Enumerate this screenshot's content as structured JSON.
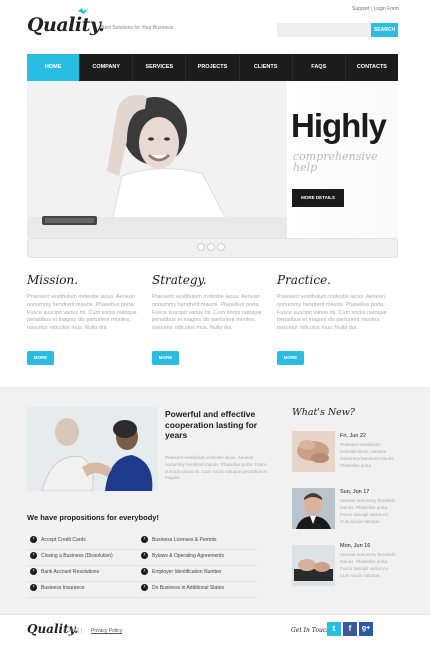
{
  "header": {
    "logo": "Quality.",
    "tagline": "Best Solutions for Your Business",
    "support": "Support",
    "login": "Login Form",
    "search_button": "SEARCH"
  },
  "nav": [
    "HOME",
    "COMPANY",
    "SERVICES",
    "PROJECTS",
    "CLIENTS",
    "FAQS",
    "CONTACTS"
  ],
  "hero": {
    "title": "Highly",
    "subtitle": "comprehensive help",
    "button": "MORE DETAILS"
  },
  "columns": [
    {
      "title": "Mission.",
      "text": "Praesent vestibulum molestie lacus. Aenean nonummy hendrerit mauris. Phasellus porta. Fusce suscipit varius mi. Cum sociis natoque penatibus et magnis dis parturient montes, nascetur ridiculus mus. Nulla dui.",
      "button": "MORE"
    },
    {
      "title": "Strategy.",
      "text": "Praesent vestibulum molestie lacus. Aenean nonummy hendrerit mauris. Phasellus porta. Fusce suscipit varius mi. Cum sociis natoque penatibus et magnis dis parturient montes, nascetur ridiculus mus. Nulla dui.",
      "button": "MORE"
    },
    {
      "title": "Practice.",
      "text": "Praesent vestibulum molestie lacus. Aenean nonummy hendrerit mauris. Phasellus porta. Fusce suscipit varius mi. Cum sociis natoque penatibus et magnis dis parturient montes, nascetur ridiculus mus. Nulla dui.",
      "button": "MORE"
    }
  ],
  "cooperation": {
    "title": "Powerful and effective cooperation lasting for years",
    "text": "Praesent vestibulum molestie lacus. Aenean nonummy hendrerit mauris. Phasellus porta. Fusce suscipit varius mi. Cum sociis natoque penatibus et magnis."
  },
  "propositions": {
    "title": "We have propositions for everybody!",
    "left": [
      "Accept Credit Cards",
      "Closing a Business (Dissolution)",
      "Bank Account Resolutions",
      "Business Insurance"
    ],
    "right": [
      "Business Licenses & Permits",
      "Bylaws & Operating Agreements",
      "Employer Identification Number",
      "Do Business in Additional States"
    ]
  },
  "news": {
    "title": "What's New?",
    "items": [
      {
        "date": "Fri, Jun 22",
        "text": "Praesent vestibulum molestie lacus. Aenean nonummy hendrerit mauris. Phasellus porta."
      },
      {
        "date": "Sun, Jun 17",
        "text": "Aenean nonummy hendrerit mauris. Phasellus porta. Fusce suscipit varius mi. Cum sociis natoque."
      },
      {
        "date": "Mon, Jun 16",
        "text": "Aenean nonummy hendrerit mauris. Phasellus porta. Fusce suscipit varius mi. Cum sociis natoque."
      }
    ]
  },
  "footer": {
    "logo": "Quality.",
    "copyright": "© 2012 |",
    "privacy": "Privacy Policy",
    "get_in_touch": "Get In Touch",
    "social": [
      "t",
      "f",
      "g+"
    ]
  },
  "colors": {
    "accent": "#29bde4",
    "dark": "#1b1b1b"
  }
}
